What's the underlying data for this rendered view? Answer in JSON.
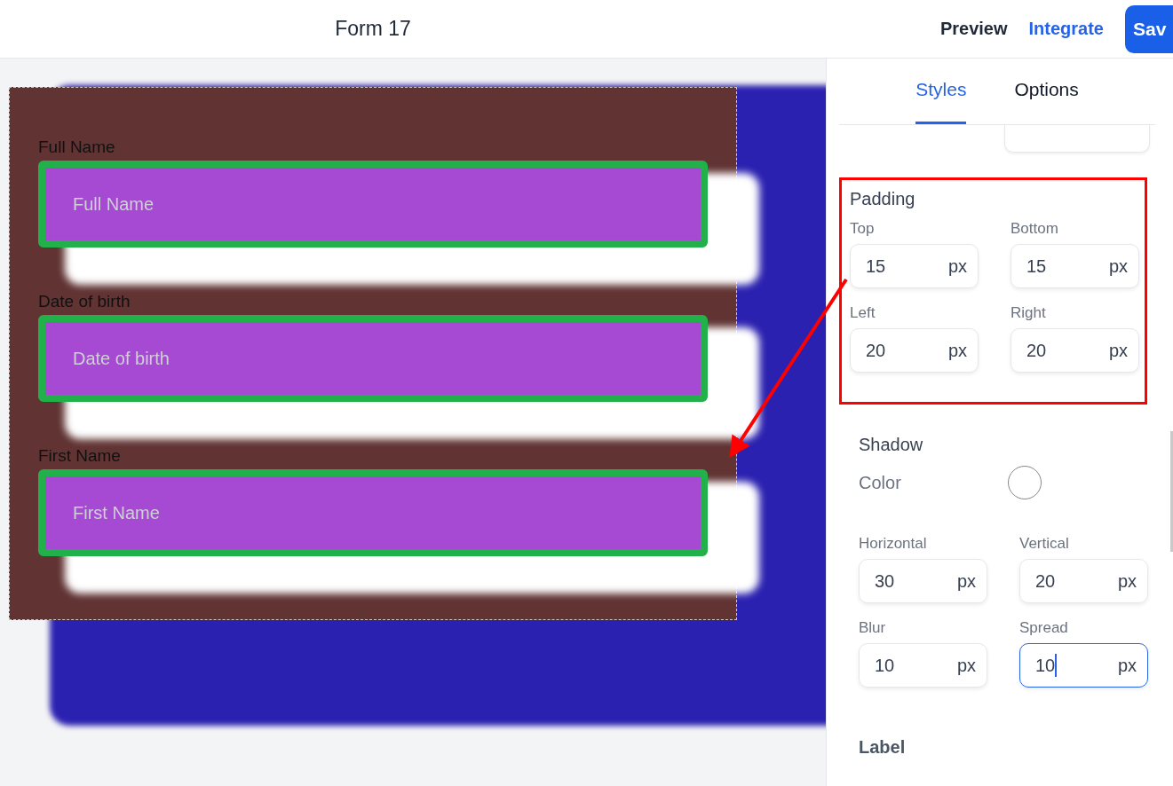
{
  "header": {
    "title": "Form 17",
    "links": [
      {
        "label": "Preview",
        "kind": "plain"
      },
      {
        "label": "Integrate",
        "kind": "accent"
      }
    ],
    "save_button": "Sav"
  },
  "form": {
    "fields": [
      {
        "label": "Full Name",
        "placeholder": "Full Name"
      },
      {
        "label": "Date of birth",
        "placeholder": "Date of birth"
      },
      {
        "label": "First Name",
        "placeholder": "First Name"
      }
    ]
  },
  "panel": {
    "tabs": [
      {
        "label": "Styles",
        "selected": true
      },
      {
        "label": "Options",
        "selected": false
      }
    ],
    "padding": {
      "title": "Padding",
      "highlighted": true,
      "inputs": [
        {
          "label": "Top",
          "value": "15",
          "unit": "px",
          "focused": false
        },
        {
          "label": "Bottom",
          "value": "15",
          "unit": "px",
          "focused": false
        },
        {
          "label": "Left",
          "value": "20",
          "unit": "px",
          "focused": false
        },
        {
          "label": "Right",
          "value": "20",
          "unit": "px",
          "focused": false
        }
      ]
    },
    "shadow": {
      "title": "Shadow",
      "color_label": "Color",
      "color": "#ffffff",
      "inputs": [
        {
          "label": "Horizontal",
          "value": "30",
          "unit": "px",
          "focused": false
        },
        {
          "label": "Vertical",
          "value": "20",
          "unit": "px",
          "focused": false
        },
        {
          "label": "Blur",
          "value": "10",
          "unit": "px",
          "focused": false
        },
        {
          "label": "Spread",
          "value": "10",
          "unit": "px",
          "focused": true
        }
      ]
    },
    "next_section": "Label"
  }
}
